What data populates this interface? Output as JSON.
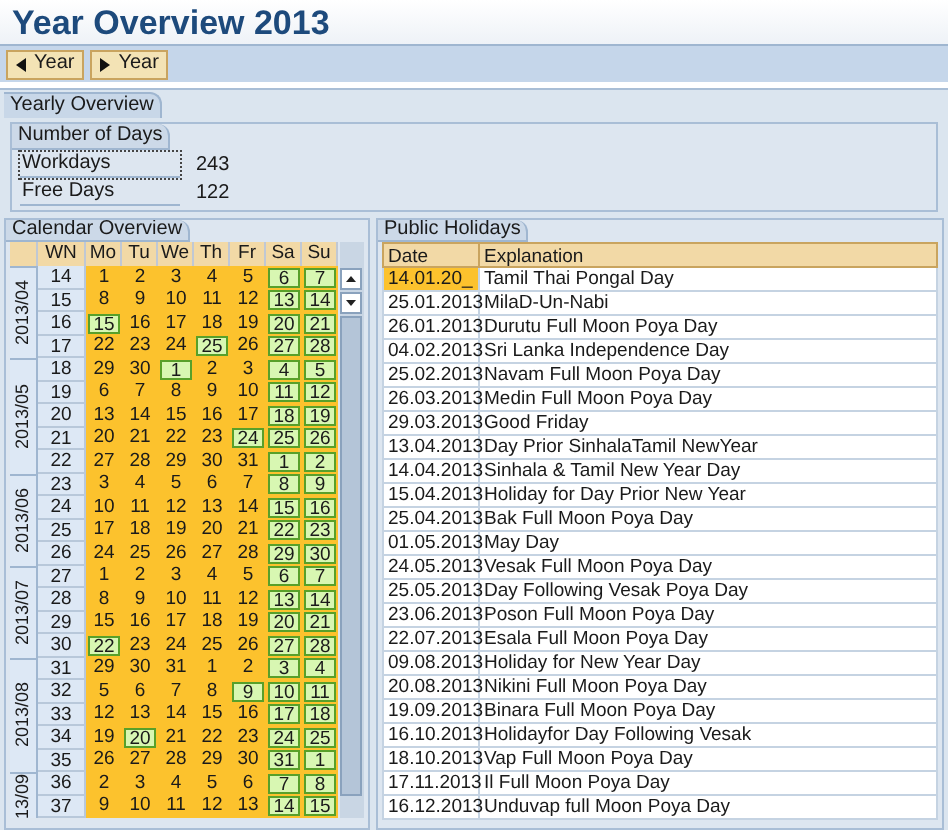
{
  "window": {
    "title": "Year Overview 2013"
  },
  "toolbar": {
    "buttons": [
      {
        "label": "Year",
        "kind": "previous"
      },
      {
        "label": "Year",
        "kind": "next"
      }
    ]
  },
  "yearly_overview": {
    "tab": "Yearly Overview",
    "group": "Number of Days",
    "fields": [
      {
        "label": "Workdays",
        "value": "243",
        "focused": true
      },
      {
        "label": "Free Days",
        "value": "122",
        "focused": false
      }
    ]
  },
  "calendar": {
    "tab": "Calendar Overview",
    "columns": [
      "WN",
      "Mo",
      "Tu",
      "We",
      "Th",
      "Fr",
      "Sa",
      "Su"
    ],
    "months": [
      {
        "label": "2013/04",
        "weeks": [
          {
            "wn": "14",
            "days": [
              {
                "d": "1",
                "free": false
              },
              {
                "d": "2",
                "free": false
              },
              {
                "d": "3",
                "free": false
              },
              {
                "d": "4",
                "free": false
              },
              {
                "d": "5",
                "free": false
              },
              {
                "d": "6",
                "free": true
              },
              {
                "d": "7",
                "free": true
              }
            ]
          },
          {
            "wn": "15",
            "days": [
              {
                "d": "8",
                "free": false
              },
              {
                "d": "9",
                "free": false
              },
              {
                "d": "10",
                "free": false
              },
              {
                "d": "11",
                "free": false
              },
              {
                "d": "12",
                "free": false
              },
              {
                "d": "13",
                "free": true
              },
              {
                "d": "14",
                "free": true
              }
            ]
          },
          {
            "wn": "16",
            "days": [
              {
                "d": "15",
                "free": true
              },
              {
                "d": "16",
                "free": false
              },
              {
                "d": "17",
                "free": false
              },
              {
                "d": "18",
                "free": false
              },
              {
                "d": "19",
                "free": false
              },
              {
                "d": "20",
                "free": true
              },
              {
                "d": "21",
                "free": true
              }
            ]
          },
          {
            "wn": "17",
            "days": [
              {
                "d": "22",
                "free": false
              },
              {
                "d": "23",
                "free": false
              },
              {
                "d": "24",
                "free": false
              },
              {
                "d": "25",
                "free": true
              },
              {
                "d": "26",
                "free": false
              },
              {
                "d": "27",
                "free": true
              },
              {
                "d": "28",
                "free": true
              }
            ]
          }
        ]
      },
      {
        "label": "2013/05",
        "weeks": [
          {
            "wn": "18",
            "days": [
              {
                "d": "29",
                "free": false
              },
              {
                "d": "30",
                "free": false
              },
              {
                "d": "1",
                "free": true
              },
              {
                "d": "2",
                "free": false
              },
              {
                "d": "3",
                "free": false
              },
              {
                "d": "4",
                "free": true
              },
              {
                "d": "5",
                "free": true
              }
            ]
          },
          {
            "wn": "19",
            "days": [
              {
                "d": "6",
                "free": false
              },
              {
                "d": "7",
                "free": false
              },
              {
                "d": "8",
                "free": false
              },
              {
                "d": "9",
                "free": false
              },
              {
                "d": "10",
                "free": false
              },
              {
                "d": "11",
                "free": true
              },
              {
                "d": "12",
                "free": true
              }
            ]
          },
          {
            "wn": "20",
            "days": [
              {
                "d": "13",
                "free": false
              },
              {
                "d": "14",
                "free": false
              },
              {
                "d": "15",
                "free": false
              },
              {
                "d": "16",
                "free": false
              },
              {
                "d": "17",
                "free": false
              },
              {
                "d": "18",
                "free": true
              },
              {
                "d": "19",
                "free": true
              }
            ]
          },
          {
            "wn": "21",
            "days": [
              {
                "d": "20",
                "free": false
              },
              {
                "d": "21",
                "free": false
              },
              {
                "d": "22",
                "free": false
              },
              {
                "d": "23",
                "free": false
              },
              {
                "d": "24",
                "free": true
              },
              {
                "d": "25",
                "free": true
              },
              {
                "d": "26",
                "free": true
              }
            ]
          },
          {
            "wn": "22",
            "days": [
              {
                "d": "27",
                "free": false
              },
              {
                "d": "28",
                "free": false
              },
              {
                "d": "29",
                "free": false
              },
              {
                "d": "30",
                "free": false
              },
              {
                "d": "31",
                "free": false
              },
              {
                "d": "1",
                "free": true
              },
              {
                "d": "2",
                "free": true
              }
            ]
          }
        ]
      },
      {
        "label": "2013/06",
        "weeks": [
          {
            "wn": "23",
            "days": [
              {
                "d": "3",
                "free": false
              },
              {
                "d": "4",
                "free": false
              },
              {
                "d": "5",
                "free": false
              },
              {
                "d": "6",
                "free": false
              },
              {
                "d": "7",
                "free": false
              },
              {
                "d": "8",
                "free": true
              },
              {
                "d": "9",
                "free": true
              }
            ]
          },
          {
            "wn": "24",
            "days": [
              {
                "d": "10",
                "free": false
              },
              {
                "d": "11",
                "free": false
              },
              {
                "d": "12",
                "free": false
              },
              {
                "d": "13",
                "free": false
              },
              {
                "d": "14",
                "free": false
              },
              {
                "d": "15",
                "free": true
              },
              {
                "d": "16",
                "free": true
              }
            ]
          },
          {
            "wn": "25",
            "days": [
              {
                "d": "17",
                "free": false
              },
              {
                "d": "18",
                "free": false
              },
              {
                "d": "19",
                "free": false
              },
              {
                "d": "20",
                "free": false
              },
              {
                "d": "21",
                "free": false
              },
              {
                "d": "22",
                "free": true
              },
              {
                "d": "23",
                "free": true
              }
            ]
          },
          {
            "wn": "26",
            "days": [
              {
                "d": "24",
                "free": false
              },
              {
                "d": "25",
                "free": false
              },
              {
                "d": "26",
                "free": false
              },
              {
                "d": "27",
                "free": false
              },
              {
                "d": "28",
                "free": false
              },
              {
                "d": "29",
                "free": true
              },
              {
                "d": "30",
                "free": true
              }
            ]
          }
        ]
      },
      {
        "label": "2013/07",
        "weeks": [
          {
            "wn": "27",
            "days": [
              {
                "d": "1",
                "free": false
              },
              {
                "d": "2",
                "free": false
              },
              {
                "d": "3",
                "free": false
              },
              {
                "d": "4",
                "free": false
              },
              {
                "d": "5",
                "free": false
              },
              {
                "d": "6",
                "free": true
              },
              {
                "d": "7",
                "free": true
              }
            ]
          },
          {
            "wn": "28",
            "days": [
              {
                "d": "8",
                "free": false
              },
              {
                "d": "9",
                "free": false
              },
              {
                "d": "10",
                "free": false
              },
              {
                "d": "11",
                "free": false
              },
              {
                "d": "12",
                "free": false
              },
              {
                "d": "13",
                "free": true
              },
              {
                "d": "14",
                "free": true
              }
            ]
          },
          {
            "wn": "29",
            "days": [
              {
                "d": "15",
                "free": false
              },
              {
                "d": "16",
                "free": false
              },
              {
                "d": "17",
                "free": false
              },
              {
                "d": "18",
                "free": false
              },
              {
                "d": "19",
                "free": false
              },
              {
                "d": "20",
                "free": true
              },
              {
                "d": "21",
                "free": true
              }
            ]
          },
          {
            "wn": "30",
            "days": [
              {
                "d": "22",
                "free": true
              },
              {
                "d": "23",
                "free": false
              },
              {
                "d": "24",
                "free": false
              },
              {
                "d": "25",
                "free": false
              },
              {
                "d": "26",
                "free": false
              },
              {
                "d": "27",
                "free": true
              },
              {
                "d": "28",
                "free": true
              }
            ]
          }
        ]
      },
      {
        "label": "2013/08",
        "weeks": [
          {
            "wn": "31",
            "days": [
              {
                "d": "29",
                "free": false
              },
              {
                "d": "30",
                "free": false
              },
              {
                "d": "31",
                "free": false
              },
              {
                "d": "1",
                "free": false
              },
              {
                "d": "2",
                "free": false
              },
              {
                "d": "3",
                "free": true
              },
              {
                "d": "4",
                "free": true
              }
            ]
          },
          {
            "wn": "32",
            "days": [
              {
                "d": "5",
                "free": false
              },
              {
                "d": "6",
                "free": false
              },
              {
                "d": "7",
                "free": false
              },
              {
                "d": "8",
                "free": false
              },
              {
                "d": "9",
                "free": true
              },
              {
                "d": "10",
                "free": true
              },
              {
                "d": "11",
                "free": true
              }
            ]
          },
          {
            "wn": "33",
            "days": [
              {
                "d": "12",
                "free": false
              },
              {
                "d": "13",
                "free": false
              },
              {
                "d": "14",
                "free": false
              },
              {
                "d": "15",
                "free": false
              },
              {
                "d": "16",
                "free": false
              },
              {
                "d": "17",
                "free": true
              },
              {
                "d": "18",
                "free": true
              }
            ]
          },
          {
            "wn": "34",
            "days": [
              {
                "d": "19",
                "free": false
              },
              {
                "d": "20",
                "free": true
              },
              {
                "d": "21",
                "free": false
              },
              {
                "d": "22",
                "free": false
              },
              {
                "d": "23",
                "free": false
              },
              {
                "d": "24",
                "free": true
              },
              {
                "d": "25",
                "free": true
              }
            ]
          },
          {
            "wn": "35",
            "days": [
              {
                "d": "26",
                "free": false
              },
              {
                "d": "27",
                "free": false
              },
              {
                "d": "28",
                "free": false
              },
              {
                "d": "29",
                "free": false
              },
              {
                "d": "30",
                "free": false
              },
              {
                "d": "31",
                "free": true
              },
              {
                "d": "1",
                "free": true
              }
            ]
          }
        ]
      },
      {
        "label": "13/09",
        "weeks": [
          {
            "wn": "36",
            "days": [
              {
                "d": "2",
                "free": false
              },
              {
                "d": "3",
                "free": false
              },
              {
                "d": "4",
                "free": false
              },
              {
                "d": "5",
                "free": false
              },
              {
                "d": "6",
                "free": false
              },
              {
                "d": "7",
                "free": true
              },
              {
                "d": "8",
                "free": true
              }
            ]
          },
          {
            "wn": "37",
            "days": [
              {
                "d": "9",
                "free": false
              },
              {
                "d": "10",
                "free": false
              },
              {
                "d": "11",
                "free": false
              },
              {
                "d": "12",
                "free": false
              },
              {
                "d": "13",
                "free": false
              },
              {
                "d": "14",
                "free": true
              },
              {
                "d": "15",
                "free": true
              }
            ]
          }
        ]
      }
    ]
  },
  "holidays": {
    "tab": "Public Holidays",
    "columns": [
      "Date",
      "Explanation"
    ],
    "rows": [
      {
        "date": "14.01.20_",
        "explanation": "Tamil Thai Pongal Day",
        "selected": true
      },
      {
        "date": "25.01.2013",
        "explanation": "MilaD-Un-Nabi",
        "selected": false
      },
      {
        "date": "26.01.2013",
        "explanation": "Durutu Full Moon Poya Day",
        "selected": false
      },
      {
        "date": "04.02.2013",
        "explanation": "Sri Lanka Independence Day",
        "selected": false
      },
      {
        "date": "25.02.2013",
        "explanation": "Navam Full Moon Poya Day",
        "selected": false
      },
      {
        "date": "26.03.2013",
        "explanation": "Medin Full Moon Poya Day",
        "selected": false
      },
      {
        "date": "29.03.2013",
        "explanation": "Good Friday",
        "selected": false
      },
      {
        "date": "13.04.2013",
        "explanation": "Day Prior SinhalaTamil NewYear",
        "selected": false
      },
      {
        "date": "14.04.2013",
        "explanation": "Sinhala & Tamil New Year Day",
        "selected": false
      },
      {
        "date": "15.04.2013",
        "explanation": "Holiday for Day Prior New Year",
        "selected": false
      },
      {
        "date": "25.04.2013",
        "explanation": "Bak Full Moon Poya Day",
        "selected": false
      },
      {
        "date": "01.05.2013",
        "explanation": "May Day",
        "selected": false
      },
      {
        "date": "24.05.2013",
        "explanation": "Vesak Full Moon Poya Day",
        "selected": false
      },
      {
        "date": "25.05.2013",
        "explanation": "Day Following Vesak Poya Day",
        "selected": false
      },
      {
        "date": "23.06.2013",
        "explanation": "Poson Full Moon Poya Day",
        "selected": false
      },
      {
        "date": "22.07.2013",
        "explanation": "Esala Full Moon Poya Day",
        "selected": false
      },
      {
        "date": "09.08.2013",
        "explanation": "Holiday for New Year Day",
        "selected": false
      },
      {
        "date": "20.08.2013",
        "explanation": "Nikini Full Moon Poya Day",
        "selected": false
      },
      {
        "date": "19.09.2013",
        "explanation": "Binara Full Moon Poya Day",
        "selected": false
      },
      {
        "date": "16.10.2013",
        "explanation": "Holidayfor Day Following Vesak",
        "selected": false
      },
      {
        "date": "18.10.2013",
        "explanation": "Vap Full Moon Poya Day",
        "selected": false
      },
      {
        "date": "17.11.2013",
        "explanation": "Il Full Moon Poya Day",
        "selected": false
      },
      {
        "date": "16.12.2013",
        "explanation": "Unduvap full Moon Poya Day",
        "selected": false
      }
    ]
  }
}
